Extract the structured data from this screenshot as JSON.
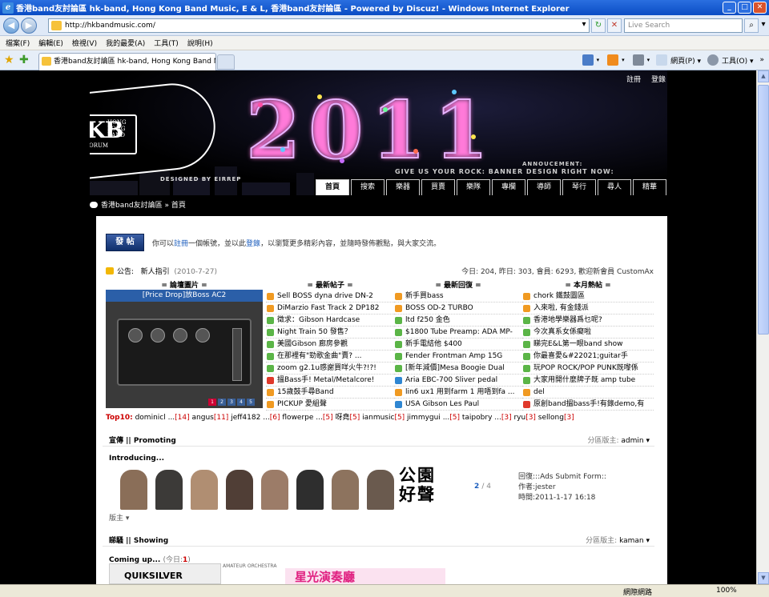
{
  "window": {
    "title": "香港band友討論區 hk-band, Hong Kong Band Music, E & L, 香港band友討論區 - Powered by Discuz! - Windows Internet Explorer",
    "controls": [
      "_",
      "□",
      "✕"
    ]
  },
  "address_bar": {
    "url": "http://hkbandmusic.com/",
    "search_placeholder": "Live Search"
  },
  "menu": [
    "檔案(F)",
    "編輯(E)",
    "檢視(V)",
    "我的最愛(A)",
    "工具(T)",
    "說明(H)"
  ],
  "tab": {
    "title": "香港band友討論區 hk-band, Hong Kong Band Music,..."
  },
  "commands": {
    "page": "網頁(P) ▾",
    "tools": "工具(O) ▾"
  },
  "status": {
    "zone": "網際網路",
    "zoom": "100%"
  },
  "banner": {
    "logo_main": "HKB",
    "logo_side": [
      "HONG",
      "KONG",
      "BAND"
    ],
    "logo_sub": "BAND FORUM",
    "year": "2011",
    "designed_by": "DESIGNED BY EIRREP",
    "announcement_label": "ANNOUCEMENT:",
    "announcement_text": "GIVE US YOUR ROCK: BANNER DESIGN RIGHT NOW:"
  },
  "top_links": [
    "註冊",
    "登錄"
  ],
  "nav_tabs": [
    "首頁",
    "搜索",
    "樂器",
    "買賣",
    "樂隊",
    "專欄",
    "導師",
    "琴行",
    "尋人",
    "精華"
  ],
  "breadcrumb": "香港band友討論區 » 首頁",
  "post_button": "發 帖",
  "welcome": {
    "pre": "你可以",
    "reg": "註冊",
    "mid": "一個帳號，並以此",
    "login": "登錄",
    "post": "，以瀏覽更多精彩內容，並隨時發佈觀點，與大家交流。"
  },
  "announcement": {
    "label": "公告:",
    "title": "新人指引",
    "date": "(2010-7-27)",
    "stats": "今日: 204, 昨日: 303, 會員: 6293, 歡迎新會員 CustomAx"
  },
  "columns": {
    "image_head": "= 論壇圖片 =",
    "posts_head": "= 最新帖子 =",
    "replies_head": "= 最新回復 =",
    "hot_head": "= 本月熱帖 ="
  },
  "image_caption": "[Price Drop]放Boss AC2",
  "image_pages": [
    "1",
    "2",
    "3",
    "4",
    "5"
  ],
  "latest_posts": [
    {
      "t": "Sell BOSS dyna drive DN-2",
      "c": "#f09a22"
    },
    {
      "t": "DiMarzio Fast Track 2 DP182",
      "c": "#f09a22"
    },
    {
      "t": "徵求：Gibson Hardcase",
      "c": "#5bb547"
    },
    {
      "t": "Night Train 50 發售？",
      "c": "#5bb547"
    },
    {
      "t": "美國Gibson 廊房參觀",
      "c": "#5bb547"
    },
    {
      "t": "在那裡有\"勁歌金曲\"賣? ...",
      "c": "#5bb547"
    },
    {
      "t": "zoom g2.1u感謝買咩火牛?!?!",
      "c": "#5bb547"
    },
    {
      "t": "搵Bass手! Metal/Metalcore!",
      "c": "#e0392b"
    },
    {
      "t": "15歲鼓手尋Band",
      "c": "#f09a22"
    },
    {
      "t": "PICKUP 愛組聲",
      "c": "#f09a22"
    }
  ],
  "latest_replies": [
    {
      "t": "新手買bass",
      "c": "#f09a22"
    },
    {
      "t": "BOSS OD-2 TURBO",
      "c": "#f09a22"
    },
    {
      "t": "ltd f250 金色",
      "c": "#5bb547"
    },
    {
      "t": "$1800 Tube Preamp: ADA MP-",
      "c": "#5bb547"
    },
    {
      "t": "新手電結他 $400",
      "c": "#5bb547"
    },
    {
      "t": "Fender Frontman Amp 15G",
      "c": "#5bb547"
    },
    {
      "t": "[新年減價]Mesa Boogie Dual",
      "c": "#5bb547"
    },
    {
      "t": "Aria EBC-700 Sliver pedal",
      "c": "#2f86d2"
    },
    {
      "t": "lin6 ux1 用到farm 1 用唔到fa ...",
      "c": "#f09a22"
    },
    {
      "t": "USA Gibson Les Paul",
      "c": "#2f86d2"
    }
  ],
  "hot_posts": [
    {
      "t": "chork 鐵鼓圖區",
      "c": "#f09a22"
    },
    {
      "t": "入來啦, 有金錢派",
      "c": "#f09a22"
    },
    {
      "t": "香港地學樂器爲乜呢?",
      "c": "#5bb547"
    },
    {
      "t": "今次真系女係癡啦",
      "c": "#5bb547"
    },
    {
      "t": "睇完E&L第一眼band show",
      "c": "#5bb547"
    },
    {
      "t": "你最喜愛&#22021;guitar手",
      "c": "#5bb547"
    },
    {
      "t": "玩POP ROCK/POP PUNK既嚟係",
      "c": "#5bb547"
    },
    {
      "t": "大家用開什麼牌子既 amp tube",
      "c": "#5bb547"
    },
    {
      "t": "del",
      "c": "#f09a22"
    },
    {
      "t": "原創band搵bass手!有錄demo,有",
      "c": "#e0392b"
    }
  ],
  "top10": {
    "label": "Top10:",
    "entries": [
      {
        "name": "dominicl ...",
        "n": "[14]"
      },
      {
        "name": "angus",
        "n": "[11]"
      },
      {
        "name": "jeff4182 ...",
        "n": "[6]"
      },
      {
        "name": "flowerpe ...",
        "n": "[5]"
      },
      {
        "name": "呀堯",
        "n": "[5]"
      },
      {
        "name": "ianmusic",
        "n": "[5]"
      },
      {
        "name": "jimmygui ...",
        "n": "[5]"
      },
      {
        "name": "taipobry ...",
        "n": "[3]"
      },
      {
        "name": "ryu",
        "n": "[3]"
      },
      {
        "name": "sellong",
        "n": "[3]"
      }
    ]
  },
  "section_promoting": {
    "title": "宣傳 || Promoting",
    "mod_label": "分區版主:",
    "mod": "admin ▾",
    "sub": "Introducing...",
    "promo_text": "公園\n好聲",
    "pager": "2",
    "pager_total": "/ 4",
    "meta": [
      "回復:::Ads Submit Form::",
      "作者:jester",
      "時間:2011-1-17 16:18"
    ],
    "moderator_row": "版主 ▾"
  },
  "section_showing": {
    "title": "睇騷 || Showing",
    "mod_label": "分區版主:",
    "mod": "kaman ▾",
    "sub": "Coming up...",
    "today_pre": "(今日:",
    "today_n": "1",
    "today_post": ")",
    "img_texts": [
      "QUIKSILVER",
      "AMATEUR ORCHESTRA",
      "星光演奏廳"
    ]
  }
}
